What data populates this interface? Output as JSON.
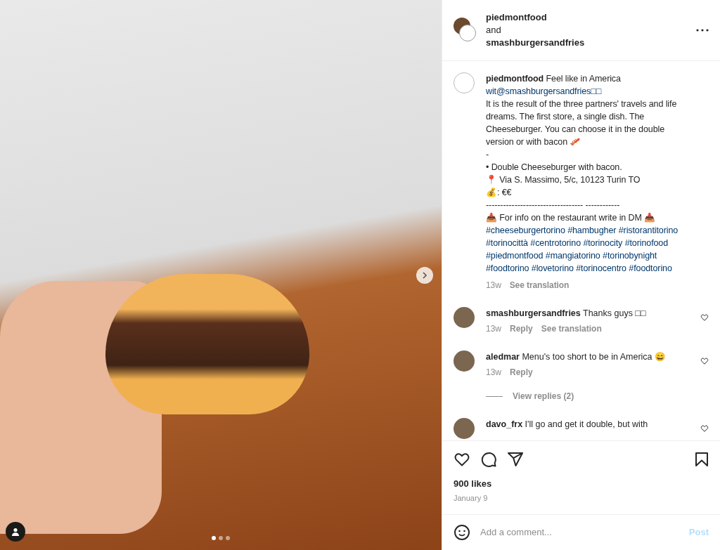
{
  "photo": {
    "slides": [
      {
        "selected": true
      },
      {
        "selected": false
      },
      {
        "selected": false
      }
    ]
  },
  "header": {
    "author": "piedmontfood",
    "joiner": " and",
    "coauthor": "smashburgersandfries"
  },
  "caption": {
    "author": "piedmontfood",
    "text": "Feel like in America",
    "mention": "wit@smashburgersandfries□□",
    "lines": [
      "It is the result of the three partners' travels and life dreams. The first store, a single dish. The Cheeseburger. You can choose it in the double version or with bacon 🥓",
      "-",
      "• Double Cheeseburger with bacon.",
      "📍 Via S. Massimo, 5/c, 10123 Turin TO",
      "💰: €€",
      "---------------------------------- ------------",
      "📥 For info on the restaurant write in DM 📥"
    ],
    "hashtags": [
      "#cheeseburgertorino",
      "#hambugher",
      "#ristorantitorino",
      "#torinocittà",
      "#centrotorino",
      "#torinocity",
      "#torinofood",
      "#piedmontfood",
      "#mangiatorino",
      "#torinobynight",
      "#foodtorino",
      "#lovetorino",
      "#torinocentro",
      "#foodtorino"
    ],
    "time": "13w",
    "translate": "See translation"
  },
  "comments": [
    {
      "user": "smashburgersandfries",
      "text": "Thanks guys □□",
      "time": "13w",
      "actions": [
        "Reply",
        "See translation"
      ],
      "liked": false
    },
    {
      "user": "aledmar",
      "text": "Menu's too short to be in America 😄",
      "time": "13w",
      "actions": [
        "Reply"
      ],
      "liked": false,
      "replies": "View replies (2)"
    },
    {
      "user": "davo_frx",
      "text": "I'll go and get it double, but with",
      "liked": false
    }
  ],
  "actions": {
    "liked": false,
    "saved": false
  },
  "likes": "900 likes",
  "date": "January 9",
  "comment_box": {
    "placeholder": "Add a comment...",
    "post": "Post"
  }
}
